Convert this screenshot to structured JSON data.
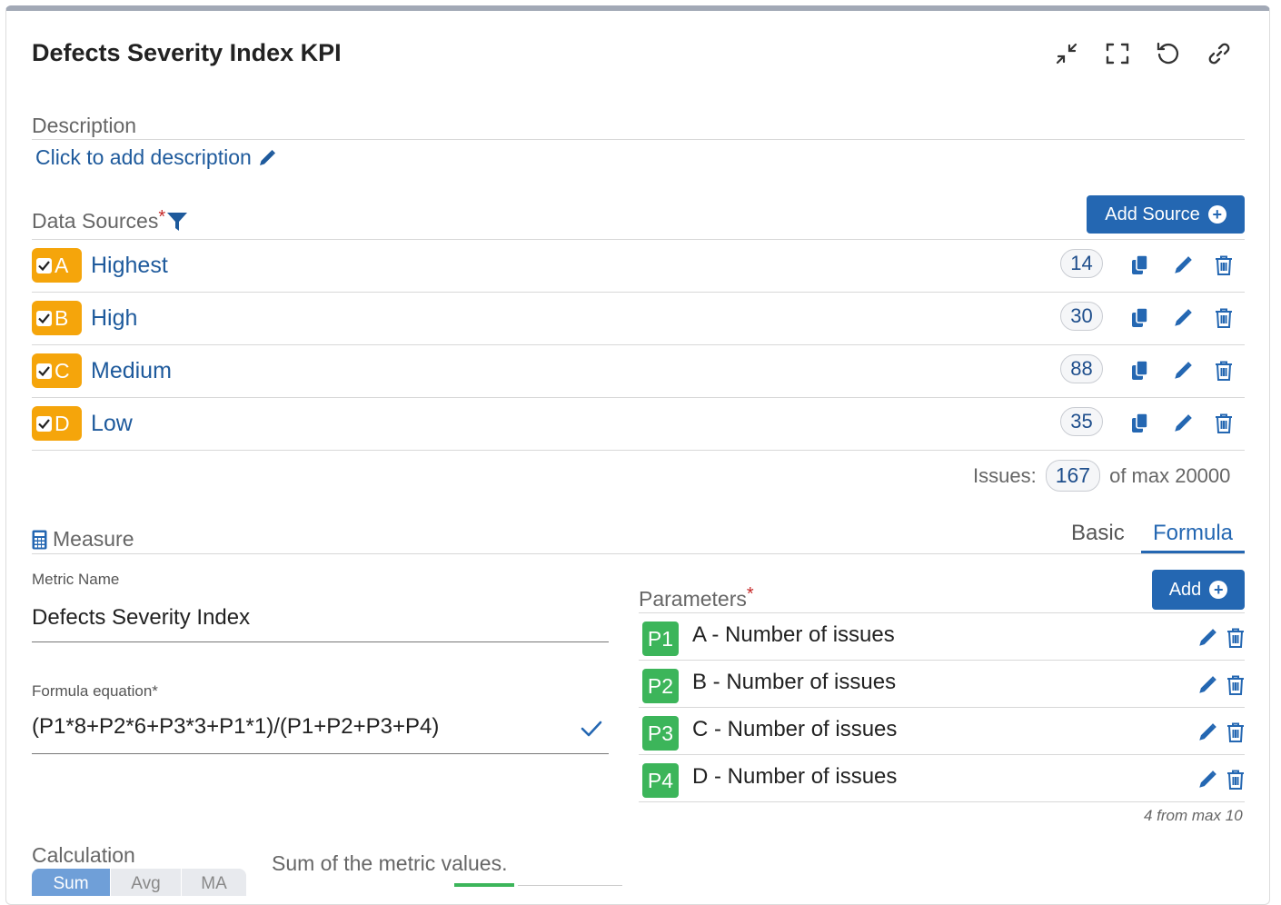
{
  "header": {
    "title": "Defects Severity Index KPI"
  },
  "description": {
    "label": "Description",
    "placeholder_link": "Click to add description"
  },
  "data_sources": {
    "label": "Data Sources",
    "required_mark": "*",
    "add_button": "Add Source",
    "items": [
      {
        "letter": "A",
        "name": "Highest",
        "count": "14"
      },
      {
        "letter": "B",
        "name": "High",
        "count": "30"
      },
      {
        "letter": "C",
        "name": "Medium",
        "count": "88"
      },
      {
        "letter": "D",
        "name": "Low",
        "count": "35"
      }
    ],
    "issues_label": "Issues:",
    "issues_total": "167",
    "issues_max": "of max 20000"
  },
  "measure": {
    "label": "Measure",
    "tabs": [
      {
        "label": "Basic",
        "active": false
      },
      {
        "label": "Formula",
        "active": true
      }
    ],
    "metric_name_label": "Metric Name",
    "metric_name_value": "Defects Severity Index",
    "formula_label": "Formula equation*",
    "formula_value": "(P1*8+P2*6+P3*3+P1*1)/(P1+P2+P3+P4)",
    "parameters_label": "Parameters",
    "parameters_required": "*",
    "add_button": "Add",
    "parameters": [
      {
        "id": "P1",
        "text": "A - Number of issues"
      },
      {
        "id": "P2",
        "text": "B - Number of issues"
      },
      {
        "id": "P3",
        "text": "C - Number of issues"
      },
      {
        "id": "P4",
        "text": "D - Number of issues"
      }
    ],
    "parameters_count_note": "4 from max 10"
  },
  "calculation": {
    "label": "Calculation",
    "options": [
      "Sum",
      "Avg",
      "MA"
    ],
    "selected": "Sum",
    "description": "Sum of the metric values."
  },
  "colors": {
    "accent": "#2467b2",
    "link": "#1e5a9c",
    "source_badge": "#f5a50b",
    "parameter_badge": "#3cb55a",
    "required": "#c62828",
    "top_border": "#a2a9b6"
  }
}
